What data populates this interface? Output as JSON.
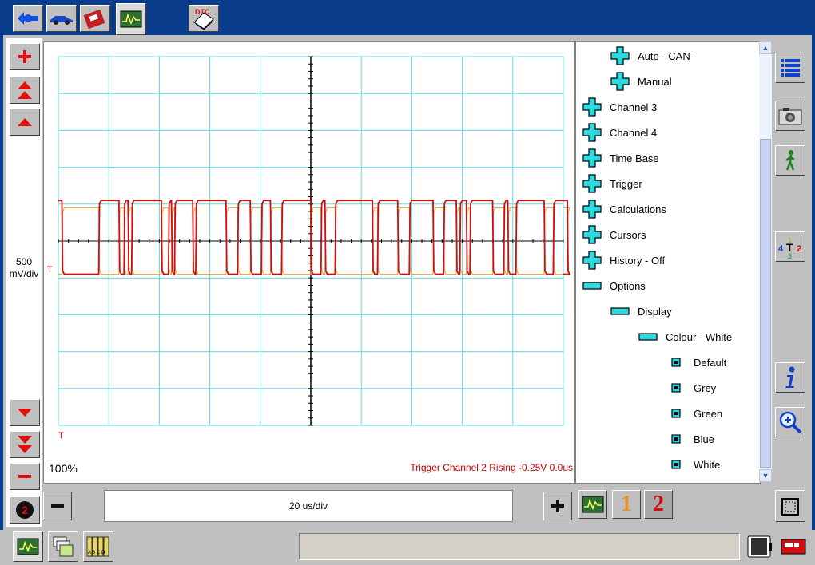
{
  "top_tabs": [
    {
      "icon": "connect-icon"
    },
    {
      "icon": "vehicle-icon"
    },
    {
      "icon": "toolbox-icon"
    },
    {
      "icon": "scope-icon"
    },
    {
      "icon": "dtc-icon",
      "label": "DTC"
    }
  ],
  "scope": {
    "vscale_value": "500",
    "vscale_unit": "mV/div",
    "zoom": "100%",
    "trigger_info": "Trigger Channel 2 Rising -0.25V 0.0us",
    "trigger_marker": "T",
    "time_per_div": "20 us/div"
  },
  "channel_buttons": {
    "ch1": "1",
    "ch2": "2"
  },
  "tree": [
    {
      "label": "Auto - CAN-",
      "level": 1,
      "icon": "plus-icon"
    },
    {
      "label": "Manual",
      "level": 1,
      "icon": "plus-icon"
    },
    {
      "label": "Channel 3",
      "level": 0,
      "icon": "plus-icon"
    },
    {
      "label": "Channel 4",
      "level": 0,
      "icon": "plus-icon"
    },
    {
      "label": "Time Base",
      "level": 0,
      "icon": "plus-icon"
    },
    {
      "label": "Trigger",
      "level": 0,
      "icon": "plus-icon"
    },
    {
      "label": "Calculations",
      "level": 0,
      "icon": "plus-icon"
    },
    {
      "label": "Cursors",
      "level": 0,
      "icon": "plus-icon"
    },
    {
      "label": "History - Off",
      "level": 0,
      "icon": "plus-icon"
    },
    {
      "label": "Options",
      "level": 0,
      "icon": "minus-icon"
    },
    {
      "label": "Display",
      "level": 1,
      "icon": "minus-icon"
    },
    {
      "label": "Colour - White",
      "level": 2,
      "icon": "minus-icon"
    },
    {
      "label": "Default",
      "level": 3,
      "icon": "square-icon"
    },
    {
      "label": "Grey",
      "level": 3,
      "icon": "square-icon"
    },
    {
      "label": "Green",
      "level": 3,
      "icon": "square-icon"
    },
    {
      "label": "Blue",
      "level": 3,
      "icon": "square-icon"
    },
    {
      "label": "White",
      "level": 3,
      "icon": "square-icon"
    }
  ],
  "colors": {
    "ch1": "#e8a030",
    "ch2": "#d01010",
    "grid": "#60d8e0",
    "accent": "#0a3c8c",
    "tree_icon": "#30d8e0"
  },
  "signal": {
    "ch2_levels": [
      0.55,
      -0.45
    ],
    "ch1_levels": [
      -0.45,
      0.45
    ],
    "edges": [
      0.7,
      8.0,
      12.0,
      13.0,
      13.8,
      14.5,
      20.4,
      21.8,
      22.4,
      23.0,
      26.6,
      27.2,
      33.2,
      35.5,
      38.0,
      40.2,
      42.0,
      44.2,
      50.0,
      52.0,
      52.8,
      54.8,
      62.2,
      63.2,
      67.2,
      69.5,
      74.2,
      76.3,
      78.8,
      79.5,
      80.8,
      81.5,
      86.0,
      88.2,
      89.0,
      90.6,
      96.2,
      98.0,
      100.8
    ]
  }
}
